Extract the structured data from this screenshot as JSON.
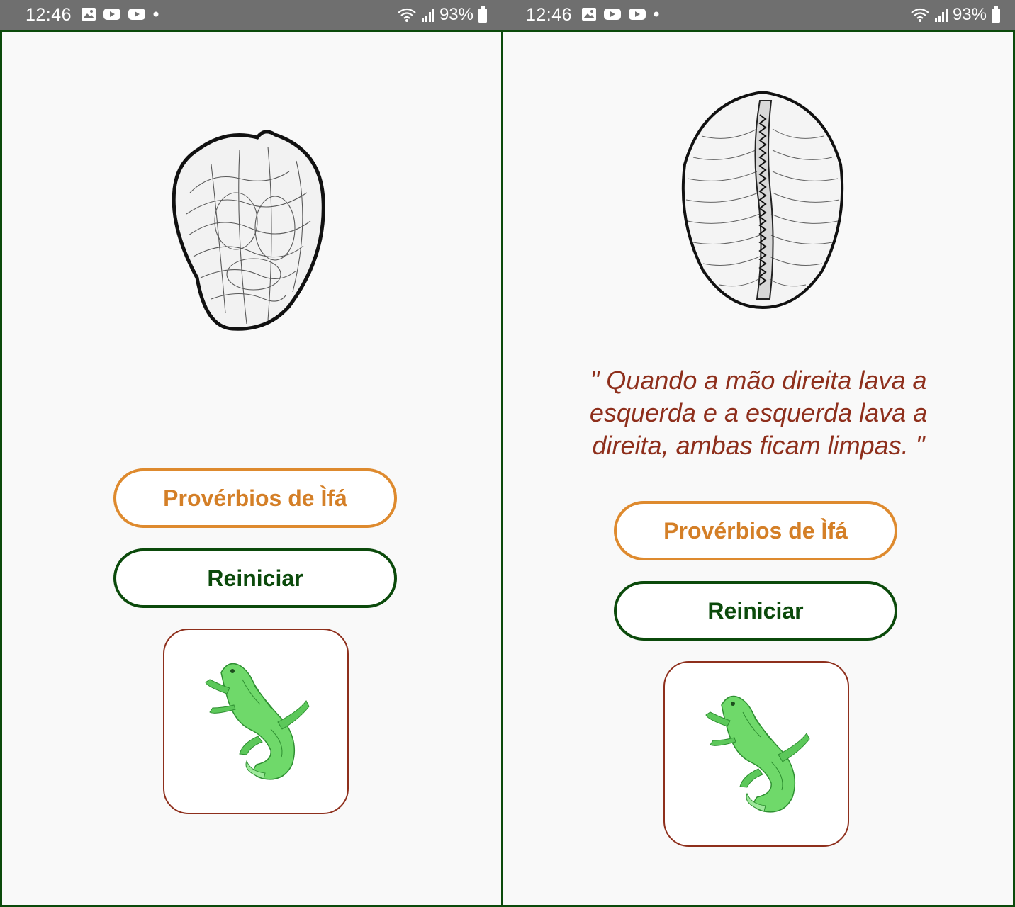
{
  "screens": [
    {
      "status": {
        "time": "12:46",
        "battery": "93%"
      },
      "seed_icon": "kola-nut-illustration",
      "proverb": "",
      "buttons": {
        "proverbs": "Provérbios de Ìfá",
        "restart": "Reiniciar"
      },
      "lizard_icon": "iguana-icon"
    },
    {
      "status": {
        "time": "12:46",
        "battery": "93%"
      },
      "seed_icon": "cowrie-shell-illustration",
      "proverb": "\" Quando a mão direita lava a esquerda e a esquerda lava a direita, ambas ficam limpas. \"",
      "buttons": {
        "proverbs": "Provérbios de Ìfá",
        "restart": "Reiniciar"
      },
      "lizard_icon": "iguana-icon"
    }
  ],
  "colors": {
    "frame": "#0b4a0b",
    "orange": "#de8a2e",
    "green": "#0b4a0b",
    "proverb": "#8e2f1c",
    "status_bar": "#6f6f6f"
  }
}
